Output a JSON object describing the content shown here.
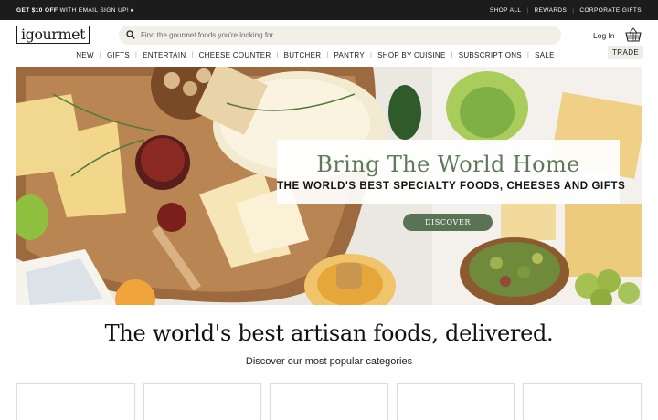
{
  "promo": {
    "bold": "GET $10 OFF",
    "rest": "WITH EMAIL SIGN UP! ▸",
    "links": [
      "SHOP ALL",
      "REWARDS",
      "CORPORATE GIFTS"
    ]
  },
  "header": {
    "logo": "igourmet",
    "search_placeholder": "Find the gourmet foods you're looking for...",
    "login": "Log In"
  },
  "nav": {
    "items": [
      "NEW",
      "GIFTS",
      "ENTERTAIN",
      "CHEESE COUNTER",
      "BUTCHER",
      "PANTRY",
      "SHOP BY CUISINE",
      "SUBSCRIPTIONS",
      "SALE"
    ],
    "trade": "TRADE"
  },
  "hero": {
    "title": "Bring The World Home",
    "subtitle": "THE WORLD'S BEST SPECIALTY FOODS, CHEESES AND GIFTS",
    "button": "DISCOVER"
  },
  "main": {
    "headline": "The world's best artisan foods, delivered.",
    "subline": "Discover our most popular categories"
  },
  "colors": {
    "accent_green": "#5b7355",
    "title_green": "#5e7a58",
    "promo_bg": "#1c1c1c"
  }
}
